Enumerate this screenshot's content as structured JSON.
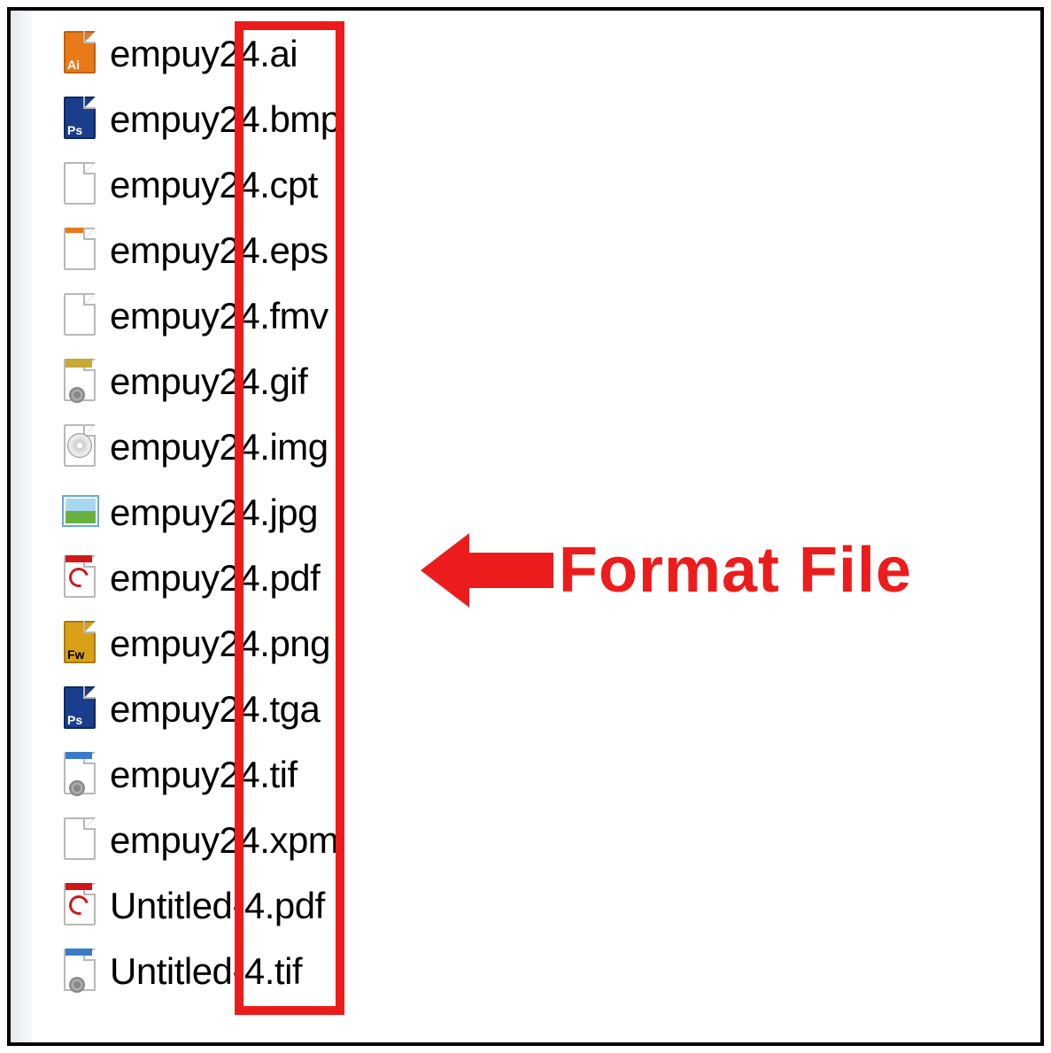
{
  "files": [
    {
      "name": "empuy24.ai",
      "icon": "ai",
      "badge": "Ai"
    },
    {
      "name": "empuy24.bmp",
      "icon": "ps",
      "badge": "Ps"
    },
    {
      "name": "empuy24.cpt",
      "icon": "blank",
      "badge": ""
    },
    {
      "name": "empuy24.eps",
      "icon": "eps",
      "badge": ""
    },
    {
      "name": "empuy24.fmv",
      "icon": "blank",
      "badge": ""
    },
    {
      "name": "empuy24.gif",
      "icon": "gif",
      "badge": ""
    },
    {
      "name": "empuy24.img",
      "icon": "img",
      "badge": ""
    },
    {
      "name": "empuy24.jpg",
      "icon": "jpg",
      "badge": ""
    },
    {
      "name": "empuy24.pdf",
      "icon": "pdf",
      "badge": ""
    },
    {
      "name": "empuy24.png",
      "icon": "fw",
      "badge": "Fw"
    },
    {
      "name": "empuy24.tga",
      "icon": "ps",
      "badge": "Ps"
    },
    {
      "name": "empuy24.tif",
      "icon": "tif",
      "badge": ""
    },
    {
      "name": "empuy24.xpm",
      "icon": "blank",
      "badge": ""
    },
    {
      "name": "Untitled-4.pdf",
      "icon": "pdf",
      "badge": ""
    },
    {
      "name": "Untitled-4.tif",
      "icon": "tif",
      "badge": ""
    }
  ],
  "annotation": {
    "label": "Format File"
  }
}
